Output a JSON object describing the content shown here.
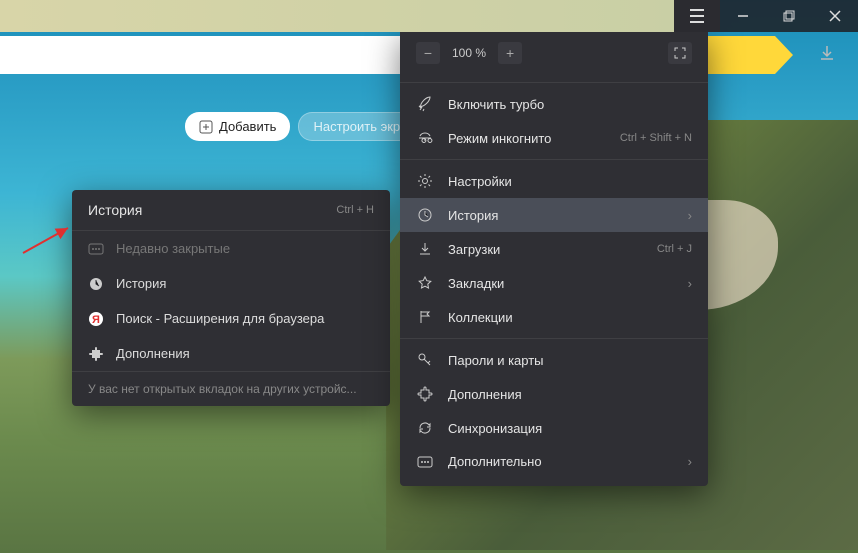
{
  "zoom": {
    "value": "100 %"
  },
  "quick": {
    "add": "Добавить",
    "customize": "Настроить экра"
  },
  "submenu": {
    "title": "История",
    "shortcut": "Ctrl + H",
    "recently_closed": "Недавно закрытые",
    "history": "История",
    "search_ext": "Поиск - Расширения для браузера",
    "addons": "Дополнения",
    "footer": "У вас нет открытых вкладок на других устройс..."
  },
  "menu": {
    "turbo": "Включить турбо",
    "incognito": "Режим инкогнито",
    "incognito_shortcut": "Ctrl + Shift + N",
    "settings": "Настройки",
    "history": "История",
    "downloads": "Загрузки",
    "downloads_shortcut": "Ctrl + J",
    "bookmarks": "Закладки",
    "collections": "Коллекции",
    "passwords": "Пароли и карты",
    "addons": "Дополнения",
    "sync": "Синхронизация",
    "more": "Дополнительно"
  }
}
